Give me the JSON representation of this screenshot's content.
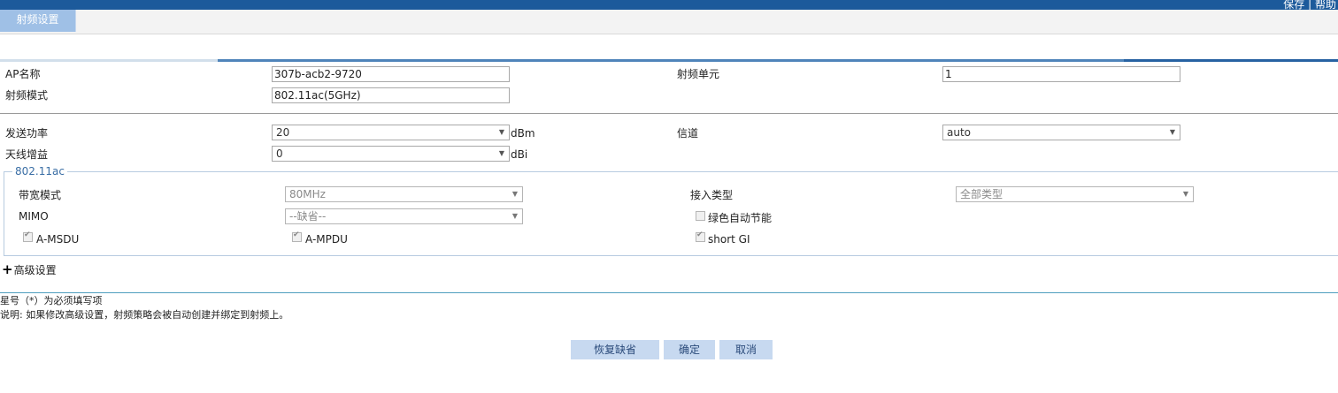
{
  "header": {
    "link_save": "保存",
    "separator": "|",
    "link_help": "帮助"
  },
  "tabs": [
    {
      "label": "射频设置",
      "active": true
    }
  ],
  "form": {
    "ap_name": {
      "label": "AP名称",
      "value": "307b-acb2-9720"
    },
    "radio_unit": {
      "label": "射频单元",
      "value": "1"
    },
    "radio_mode": {
      "label": "射频模式",
      "value": "802.11ac(5GHz)"
    },
    "tx_power": {
      "label": "发送功率",
      "value": "20",
      "unit": "dBm"
    },
    "channel": {
      "label": "信道",
      "value": "auto"
    },
    "antenna_gain": {
      "label": "天线增益",
      "value": "0",
      "unit": "dBi"
    }
  },
  "ac_section": {
    "legend": "802.11ac",
    "bandwidth_mode": {
      "label": "带宽模式",
      "value": "80MHz"
    },
    "access_type": {
      "label": "接入类型",
      "value": "全部类型"
    },
    "mimo": {
      "label": "MIMO",
      "value": "--缺省--"
    },
    "green_energy": {
      "label": "绿色自动节能",
      "checked": false
    },
    "a_msdu": {
      "label": "A-MSDU",
      "checked": true
    },
    "a_mpdu": {
      "label": "A-MPDU",
      "checked": true
    },
    "short_gi": {
      "label": "short GI",
      "checked": true
    }
  },
  "advanced": {
    "label": "高级设置"
  },
  "notes": {
    "required": "星号（*）为必须填写项",
    "explain": "说明: 如果修改高级设置，射频策略会被自动创建并绑定到射频上。"
  },
  "buttons": {
    "restore": "恢复缺省",
    "confirm": "确定",
    "cancel": "取消"
  },
  "colors": {
    "header_bg": "#1c5a9b",
    "tab_bg": "#9fc0e6",
    "button_bg": "#c7d9f0",
    "legend_text": "#3a6ea5"
  }
}
